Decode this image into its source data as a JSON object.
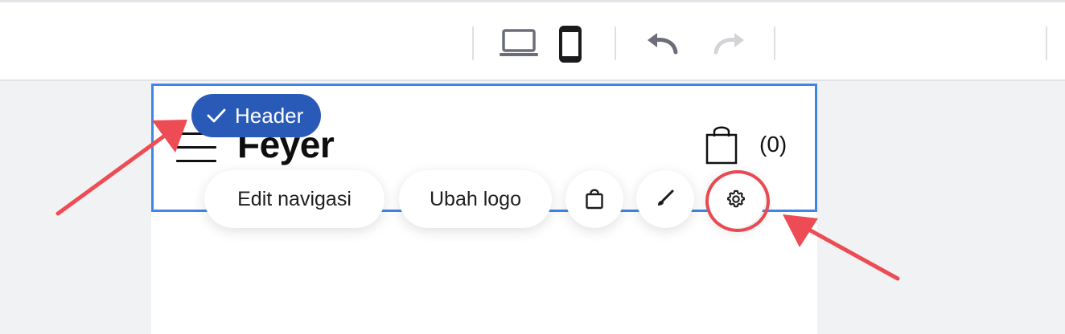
{
  "toolbar": {
    "device_desktop_icon": "laptop-icon",
    "device_mobile_icon": "mobile-phone-icon",
    "undo_icon": "undo-icon",
    "redo_icon": "redo-icon"
  },
  "header": {
    "selection_badge_label": "Header",
    "logo_text": "Feyer",
    "cart_count": "(0)"
  },
  "floating_toolbar": {
    "edit_navigation_label": "Edit navigasi",
    "change_logo_label": "Ubah logo",
    "cart_icon": "shopping-bag-icon",
    "style_icon": "paintbrush-icon",
    "settings_icon": "gear-icon"
  },
  "colors": {
    "selection_border": "#3f86ea",
    "badge_bg": "#2a5ab7",
    "annotation_red": "#e94a52",
    "canvas_bg": "#f1f2f4"
  }
}
